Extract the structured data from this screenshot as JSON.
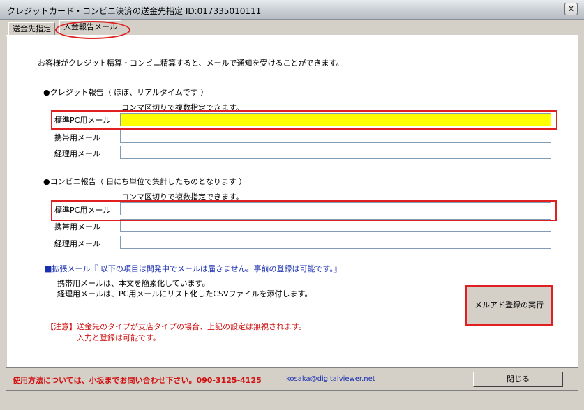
{
  "window": {
    "title": "クレジットカード・コンビニ決済の送金先指定 ID:017335010111",
    "close_glyph": "x"
  },
  "tabs": [
    {
      "label": "送金先指定"
    },
    {
      "label": "入金報告メール"
    }
  ],
  "intro_text": "お客様がクレジット精算・コンビニ精算すると、メールで通知を受けることができます。",
  "credit_section": {
    "heading": "●クレジット報告（ ほぼ、リアルタイムです ）",
    "comma_note": "コンマ区切りで複数指定できます。",
    "rows": [
      {
        "label": "標準PC用メール",
        "value": ""
      },
      {
        "label": "携帯用メール",
        "value": ""
      },
      {
        "label": "経理用メール",
        "value": ""
      }
    ]
  },
  "convenience_section": {
    "heading": "●コンビニ報告（ 日にち単位で集計したものとなります ）",
    "comma_note": "コンマ区切りで複数指定できます。",
    "rows": [
      {
        "label": "標準PC用メール",
        "value": ""
      },
      {
        "label": "携帯用メール",
        "value": ""
      },
      {
        "label": "経理用メール",
        "value": ""
      }
    ]
  },
  "extended": {
    "heading": "■拡張メール『 以下の項目は開発中でメールは届きません。事前の登録は可能です。』",
    "line1": "携帯用メールは、本文を簡素化しています。",
    "line2": "経理用メールは、PC用メールにリスト化したCSVファイルを添付します。"
  },
  "notice": {
    "line1": "【注意】送金先のタイプが支店タイプの場合、上記の設定は無視されます。",
    "line2": "入力と登録は可能です。"
  },
  "execute_button": {
    "label": "メルアド登録の実行"
  },
  "footer": {
    "contact_text": "使用方法については、小坂までお問い合わせ下さい。090-3125-4125",
    "email": "kosaka@digitalviewer.net",
    "close_label": "閉じる"
  },
  "colors": {
    "highlight_field": "#ffff00",
    "annotation_red": "#e02020",
    "info_blue": "#1a2fb0",
    "warning_red": "#d01010"
  }
}
